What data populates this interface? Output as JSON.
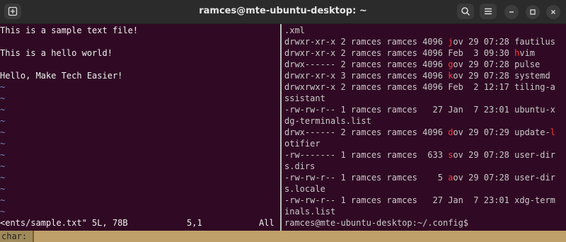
{
  "window": {
    "title": "ramces@mte-ubuntu-desktop: ~"
  },
  "toolbar": {
    "newtab_icon": "new-tab-icon",
    "search_icon": "search-icon",
    "menu_icon": "hamburger-menu-icon",
    "min_icon": "minimize-icon",
    "max_icon": "maximize-icon",
    "close_icon": "close-icon"
  },
  "vim": {
    "lines": [
      "This is a sample text file!",
      "",
      "This is a hello world!",
      "",
      "Hello, Make Tech Easier!"
    ],
    "tilde": "~",
    "status": {
      "file": "<ents/sample.txt\" 5L, 78B",
      "position": "5,1",
      "scroll": "All"
    }
  },
  "terminal": {
    "rows": [
      {
        "pre": ".xml",
        "red": "",
        "post": ""
      },
      {
        "pre": "drwxr-xr-x 2 ramces ramces 4096 ",
        "red": "j",
        "post": "ov 29 07:28 fautilus"
      },
      {
        "pre": "drwxr-xr-x 2 ramces ramces 4096 Feb  3 09:30 ",
        "red": "h",
        "post": "vim"
      },
      {
        "pre": "drwx------ 2 ramces ramces 4096 ",
        "red": "g",
        "post": "ov 29 07:28 pulse"
      },
      {
        "pre": "drwxr-xr-x 3 ramces ramces 4096 ",
        "red": "k",
        "post": "ov 29 07:28 systemd"
      },
      {
        "pre": "drwxrwxr-x 2 ramces ramces 4096 Feb  2 12:17 tiling-a",
        "red": "",
        "post": ""
      },
      {
        "pre": "ssistant",
        "red": "",
        "post": ""
      },
      {
        "pre": "-rw-rw-r-- 1 ramces ramces   27 Jan  7 23:01 ubuntu-x",
        "red": "",
        "post": ""
      },
      {
        "pre": "dg-terminals.list",
        "red": "",
        "post": ""
      },
      {
        "pre": "drwx------ 2 ramces ramces 4096 ",
        "red": "d",
        "post": "ov 29 07:29 update-"
      },
      {
        "pre": "otifier",
        "red": "",
        "post": ""
      },
      {
        "pre": "-rw------- 1 ramces ramces  633 ",
        "red": "s",
        "post": "ov 29 07:28 user-dir"
      },
      {
        "pre": "s.dirs",
        "red": "",
        "post": ""
      },
      {
        "pre": "-rw-rw-r-- 1 ramces ramces    5 ",
        "red": "a",
        "post": "ov 29 07:28 user-dir"
      },
      {
        "pre": "s.locale",
        "red": "",
        "post": ""
      },
      {
        "pre": "-rw-rw-r-- 1 ramces ramces   27 Jan  7 23:01 xdg-term",
        "red": "",
        "post": ""
      },
      {
        "pre": "inals.list",
        "red": "",
        "post": ""
      }
    ],
    "prompt": "ramces@mte-ubuntu-desktop:~/.config$"
  },
  "cmdline": {
    "label": "char:"
  }
}
